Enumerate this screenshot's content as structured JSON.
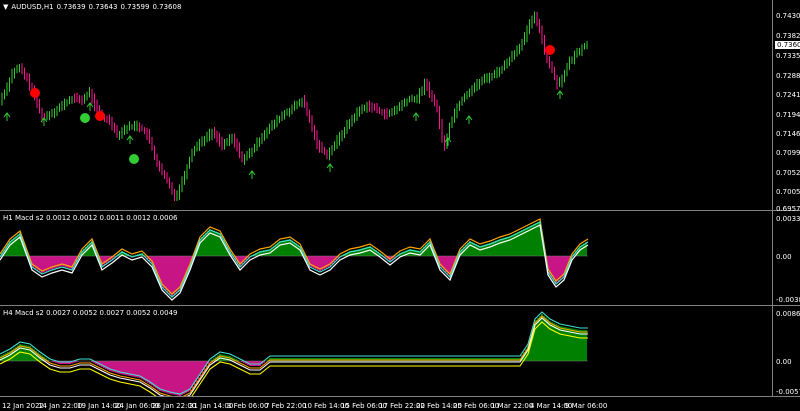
{
  "symbol": {
    "dropdown_glyph": "▼",
    "title": "AUDUSD,H1",
    "ohlc": [
      "0.73639",
      "0.73643",
      "0.73599",
      "0.73608"
    ]
  },
  "price_scale": {
    "labels": [
      "0.74300",
      "0.73820",
      "0.73608",
      "0.73350",
      "0.72880",
      "0.72410",
      "0.71940",
      "0.71460",
      "0.70990",
      "0.70520",
      "0.70050",
      "0.69570"
    ],
    "current_price": "0.73608"
  },
  "macd_h1": {
    "title": "H1 Macd s2 0.0012 0.0012 0.0011 0.0012 0.0006",
    "scale": [
      "0.0033",
      "0.00",
      "-0.0038"
    ]
  },
  "macd_h4": {
    "title": "H4 Macd s2 0.0027 0.0052 0.0027 0.0052 0.0049",
    "scale": [
      "0.0086",
      "0.00",
      "-0.0057"
    ]
  },
  "time_axis": {
    "labels": [
      "12 Jan 2022",
      "14 Jan 22:00",
      "19 Jan 14:00",
      "24 Jan 06:00",
      "26 Jan 22:00",
      "31 Jan 14:00",
      "3 Feb 06:00",
      "7 Feb 22:00",
      "10 Feb 14:00",
      "15 Feb 06:00",
      "17 Feb 22:00",
      "22 Feb 14:00",
      "25 Feb 06:00",
      "1 Mar 22:00",
      "4 Mar 14:00",
      "9 Mar 06:00"
    ]
  },
  "colors": {
    "bull": "#32cd32",
    "bear": "#ff1493",
    "signal_red": "#ff0000",
    "signal_green": "#32cd32",
    "arrow": "#32cd32",
    "hist_pos": "#008000",
    "hist_neg": "#c71585",
    "macd_line": "#ffa500",
    "macd_aqua": "#40e0d0",
    "macd_white": "#ffffff",
    "macd_yellow": "#ffff00"
  }
}
